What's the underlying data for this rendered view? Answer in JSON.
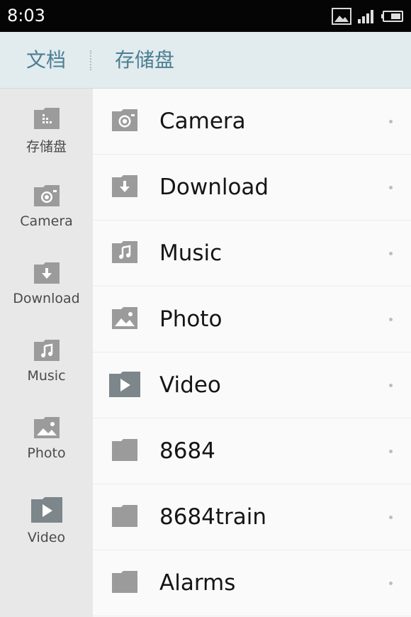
{
  "status_bar": {
    "time": "8:03",
    "icons": [
      "image-notification-icon",
      "signal-icon",
      "battery-icon"
    ]
  },
  "header": {
    "breadcrumb": [
      "文档",
      "存储盘"
    ]
  },
  "sidebar": {
    "items": [
      {
        "label": "存储盘",
        "icon": "storage-icon"
      },
      {
        "label": "Camera",
        "icon": "camera-icon"
      },
      {
        "label": "Download",
        "icon": "download-icon"
      },
      {
        "label": "Music",
        "icon": "music-icon"
      },
      {
        "label": "Photo",
        "icon": "photo-icon"
      },
      {
        "label": "Video",
        "icon": "video-icon"
      }
    ]
  },
  "list": {
    "items": [
      {
        "name": "Camera",
        "icon": "camera-folder-icon"
      },
      {
        "name": "Download",
        "icon": "download-folder-icon"
      },
      {
        "name": "Music",
        "icon": "music-folder-icon"
      },
      {
        "name": "Photo",
        "icon": "photo-folder-icon"
      },
      {
        "name": "Video",
        "icon": "video-folder-icon"
      },
      {
        "name": "8684",
        "icon": "folder-icon"
      },
      {
        "name": "8684train",
        "icon": "folder-icon"
      },
      {
        "name": "Alarms",
        "icon": "folder-icon"
      }
    ]
  },
  "colors": {
    "status_bar": "#050505",
    "header_bg": "#e2ebee",
    "breadcrumb_text": "#4a7f92",
    "sidebar_bg": "#e8e8e8",
    "list_bg": "#fafafa",
    "icon_gray": "#9b9b9b",
    "video_icon": "#7d868a"
  }
}
